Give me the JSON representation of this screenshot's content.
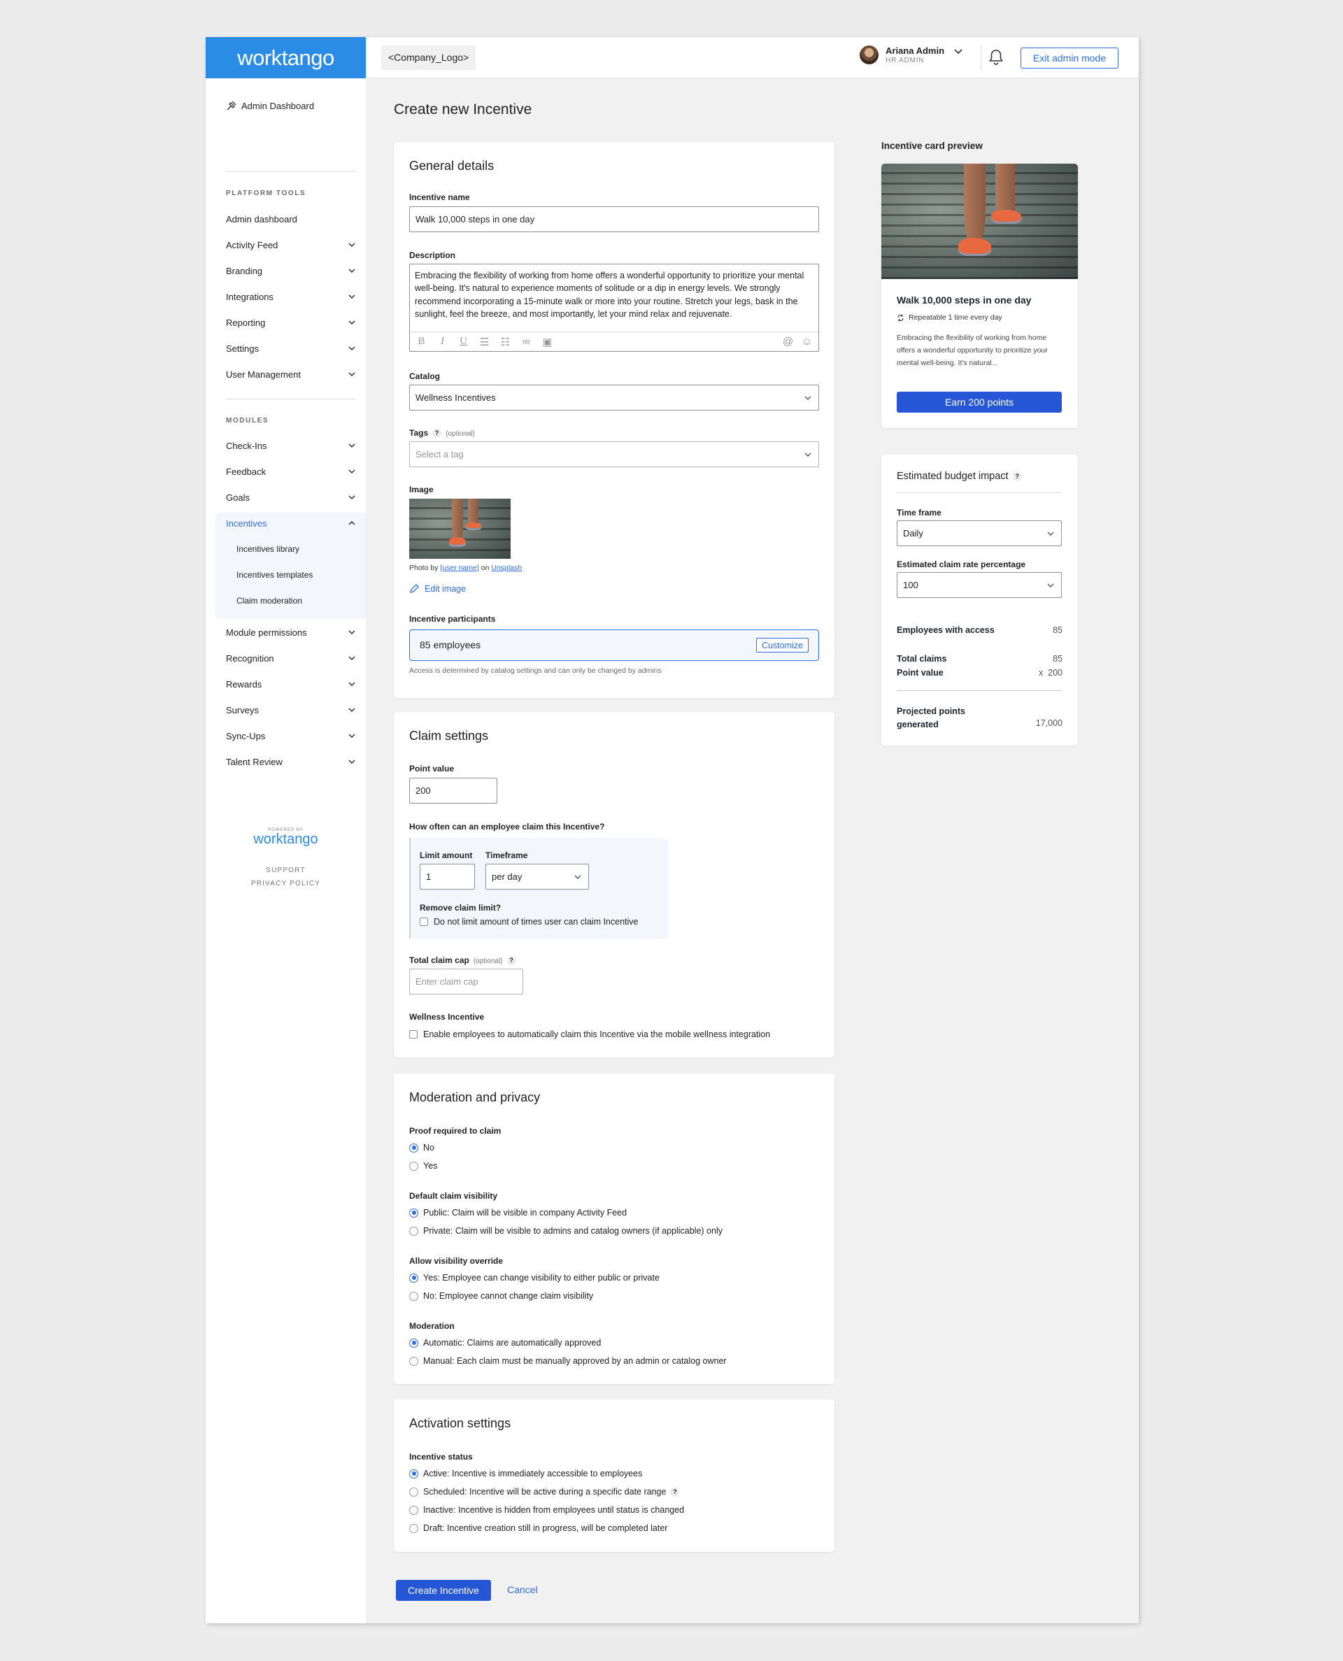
{
  "brand": {
    "logo_text": "worktango",
    "accent": "#2b8ce6",
    "primary": "#2456d6"
  },
  "topbar": {
    "company_logo": "<Company_Logo>",
    "user_name": "Ariana Admin",
    "user_role": "HR ADMIN",
    "exit_label": "Exit admin mode"
  },
  "sidebar": {
    "dashboard_link": "Admin Dashboard",
    "platform_heading": "PLATFORM TOOLS",
    "platform_items": [
      {
        "label": "Admin dashboard"
      },
      {
        "label": "Activity Feed"
      },
      {
        "label": "Branding"
      },
      {
        "label": "Integrations"
      },
      {
        "label": "Reporting"
      },
      {
        "label": "Settings"
      },
      {
        "label": "User Management"
      }
    ],
    "modules_heading": "MODULES",
    "module_items": [
      {
        "label": "Check-Ins"
      },
      {
        "label": "Feedback"
      },
      {
        "label": "Goals"
      },
      {
        "label": "Incentives"
      }
    ],
    "incentive_subitems": [
      {
        "label": "Incentives library"
      },
      {
        "label": "Incentives templates"
      },
      {
        "label": "Claim moderation"
      }
    ],
    "more_items": [
      {
        "label": "Module permissions"
      },
      {
        "label": "Recognition"
      },
      {
        "label": "Rewards"
      },
      {
        "label": "Surveys"
      },
      {
        "label": "Sync-Ups"
      },
      {
        "label": "Talent Review"
      }
    ],
    "powered_by": "POWERED BY",
    "powered_logo": "worktango",
    "support": "SUPPORT",
    "privacy": "PRIVACY POLICY"
  },
  "page": {
    "title": "Create new Incentive"
  },
  "general": {
    "title": "General details",
    "name_label": "Incentive name",
    "name_value": "Walk 10,000 steps in one day",
    "desc_label": "Description",
    "desc_value": "Embracing the flexibility of working from home offers a wonderful opportunity to prioritize your mental well-being. It's natural to experience moments of solitude or a dip in energy levels. We strongly recommend incorporating a 15-minute walk or more into your routine. Stretch your legs, bask in the sunlight, feel the breeze, and most importantly, let your mind relax and rejuvenate.",
    "catalog_label": "Catalog",
    "catalog_value": "Wellness Incentives",
    "tags_label": "Tags",
    "tags_optional": "(optional)",
    "tags_placeholder": "Select a tag",
    "image_label": "Image",
    "photo_by": "Photo by",
    "photo_user": "[user name]",
    "photo_on": "on",
    "photo_source": "Unsplash",
    "edit_image": "Edit image",
    "participants_label": "Incentive participants",
    "participants_value": "85 employees",
    "customize": "Customize",
    "participants_note": "Access is determined by catalog settings and can only be changed by admins"
  },
  "claim": {
    "title": "Claim settings",
    "point_label": "Point value",
    "point_value": "200",
    "how_often": "How often can an employee claim this Incentive?",
    "limit_label": "Limit amount",
    "limit_value": "1",
    "timeframe_label": "Timeframe",
    "timeframe_value": "per day",
    "remove_label": "Remove claim limit?",
    "remove_check": "Do not limit amount of times user can claim Incentive",
    "cap_label": "Total claim cap",
    "cap_optional": "(optional)",
    "cap_placeholder": "Enter claim cap",
    "wellness_label": "Wellness Incentive",
    "wellness_check": "Enable employees to automatically claim this Incentive via the mobile wellness integration"
  },
  "moderation": {
    "title": "Moderation and privacy",
    "proof_label": "Proof required to claim",
    "proof_options": [
      "No",
      "Yes"
    ],
    "visibility_label": "Default claim visibility",
    "visibility_options": [
      "Public: Claim will be visible in company Activity Feed",
      "Private: Claim will be visible to admins and catalog owners (if applicable) only"
    ],
    "override_label": "Allow visibility override",
    "override_options": [
      "Yes: Employee can change visibility to either public or private",
      "No: Employee cannot change claim visibility"
    ],
    "moderation_label": "Moderation",
    "moderation_options": [
      "Automatic: Claims are automatically approved",
      "Manual: Each claim must be manually approved by an admin or catalog owner"
    ]
  },
  "activation": {
    "title": "Activation settings",
    "status_label": "Incentive status",
    "status_options": [
      "Active: Incentive is immediately accessible to employees",
      "Scheduled: Incentive will be active during a specific date range",
      "Inactive: Incentive is hidden from employees until status is changed",
      "Draft: Incentive creation still in progress, will be completed later"
    ]
  },
  "actions": {
    "create": "Create Incentive",
    "cancel": "Cancel"
  },
  "preview": {
    "heading": "Incentive card preview",
    "title": "Walk 10,000 steps in one day",
    "repeat": "Repeatable 1 time every day",
    "desc": "Embracing the flexibility of working from home offers a wonderful opportunity to prioritize your mental well-being. It's natural...",
    "button": "Earn 200 points"
  },
  "budget": {
    "title": "Estimated budget impact",
    "timeframe_label": "Time frame",
    "timeframe_value": "Daily",
    "rate_label": "Estimated claim rate percentage",
    "rate_value": "100",
    "access_label": "Employees with access",
    "access_value": "85",
    "claims_label": "Total claims",
    "claims_value": "85",
    "point_label": "Point value",
    "point_value": "x  200",
    "projected_label_1": "Projected points",
    "projected_label_2": "generated",
    "projected_value": "17,000"
  }
}
